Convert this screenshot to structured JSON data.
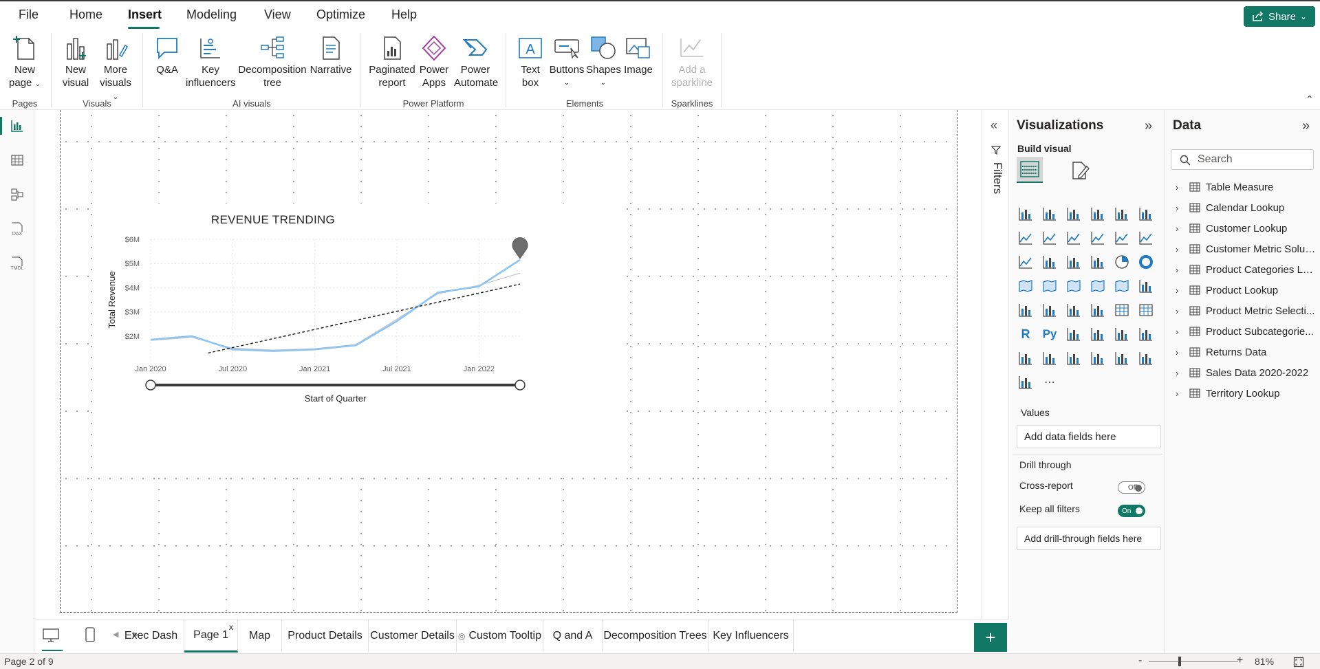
{
  "menu": {
    "tabs": [
      "File",
      "Home",
      "Insert",
      "Modeling",
      "View",
      "Optimize",
      "Help"
    ],
    "active_tab": "Insert",
    "share_label": "Share"
  },
  "ribbon": {
    "new_page": [
      "New",
      "page"
    ],
    "new_visual": [
      "New",
      "visual"
    ],
    "more_visuals": [
      "More",
      "visuals"
    ],
    "qna": "Q&A",
    "key_influencers": [
      "Key",
      "influencers"
    ],
    "decomposition_tree": [
      "Decomposition",
      "tree"
    ],
    "narrative": "Narrative",
    "paginated_report": [
      "Paginated",
      "report"
    ],
    "power_apps": [
      "Power",
      "Apps"
    ],
    "power_automate": [
      "Power",
      "Automate"
    ],
    "text_box": [
      "Text",
      "box"
    ],
    "buttons": "Buttons",
    "shapes": "Shapes",
    "image": "Image",
    "add_sparkline": [
      "Add a",
      "sparkline"
    ],
    "groups": [
      "Pages",
      "Visuals",
      "AI visuals",
      "Power Platform",
      "Elements",
      "Sparklines"
    ]
  },
  "chart_data": {
    "type": "line",
    "title": "REVENUE TRENDING",
    "xlabel": "Start of Quarter",
    "ylabel": "Total Revenue",
    "x_tick_labels": [
      "Jan 2020",
      "Jul 2020",
      "Jan 2021",
      "Jul 2021",
      "Jan 2022"
    ],
    "y_tick_labels": [
      "$6M",
      "$5M",
      "$4M",
      "$3M",
      "$2M"
    ],
    "y_ticks": [
      6,
      5,
      4,
      3,
      2
    ],
    "ylim": [
      1.0,
      6.0
    ],
    "x": [
      "2020-01",
      "2020-04",
      "2020-07",
      "2020-10",
      "2021-01",
      "2021-04",
      "2021-07",
      "2021-10",
      "2022-01",
      "2022-04"
    ],
    "series": [
      {
        "values": [
          1.85,
          2.0,
          1.45,
          1.38,
          1.45,
          1.62,
          2.62,
          3.8,
          4.05,
          5.15
        ],
        "color": "#8cc4f2"
      },
      {
        "values": [
          1.82,
          1.95,
          1.5,
          1.42,
          1.48,
          1.65,
          2.7,
          3.75,
          4.1,
          4.6
        ],
        "color": "#c8c8c8"
      }
    ],
    "trendline": {
      "start": [
        1.4,
        1.3
      ],
      "end": [
        2022.25,
        4.15
      ],
      "style": "dashed"
    },
    "grid": true,
    "range_slider": true
  },
  "viz_pane": {
    "title": "Visualizations",
    "build_visual": "Build visual",
    "values_label": "Values",
    "values_placeholder": "Add data fields here",
    "drill_through": "Drill through",
    "cross_report": "Cross-report",
    "cross_report_state": "Off",
    "keep_all_filters": "Keep all filters",
    "keep_all_filters_state": "On",
    "drill_placeholder": "Add drill-through fields here"
  },
  "filters_label": "Filters",
  "data_pane": {
    "title": "Data",
    "search_placeholder": "Search",
    "tables": [
      "Table Measure",
      "Calendar Lookup",
      "Customer Lookup",
      "Customer Metric Solut...",
      "Product Categories Lo...",
      "Product Lookup",
      "Product Metric Selecti...",
      "Product Subcategorie...",
      "Returns Data",
      "Sales Data 2020-2022",
      "Territory Lookup"
    ]
  },
  "page_tabs": [
    "Exec Dash",
    "Page 1",
    "Map",
    "Product Details",
    "Customer Details",
    "Custom Tooltip",
    "Q and A",
    "Decomposition Trees",
    "Key Influencers"
  ],
  "active_page_tab": "Page 1",
  "status": {
    "page_indicator": "Page 2 of 9",
    "zoom": "81%"
  },
  "colors": {
    "accent": "#117865",
    "line": "#8cc4f2",
    "icon_blue": "#1f7ac4"
  }
}
